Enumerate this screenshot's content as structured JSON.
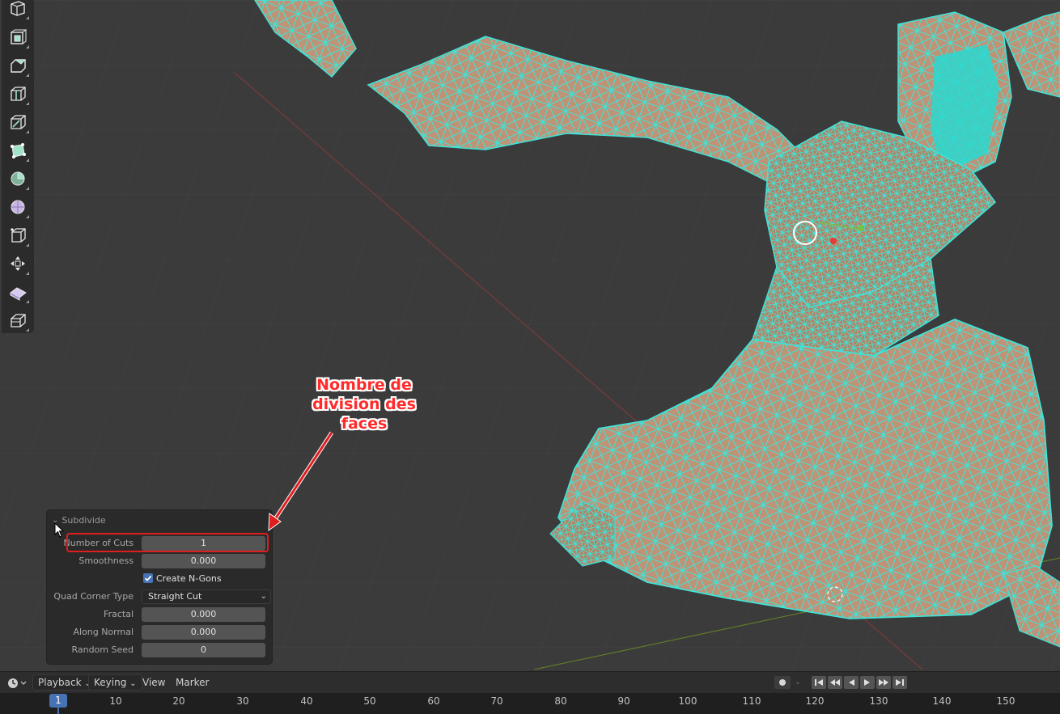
{
  "app": "Blender",
  "toolbar": {
    "tools": [
      "select-box-icon",
      "inset-faces-icon",
      "extrude-region-icon",
      "bevel-icon",
      "loop-cut-icon",
      "knife-icon",
      "poly-build-icon",
      "spin-icon",
      "smooth-vertices-icon",
      "edge-slide-icon",
      "shrink-fatten-icon",
      "shear-icon",
      "rip-region-icon"
    ]
  },
  "operator_panel": {
    "title": "Subdivide",
    "fields": {
      "number_of_cuts": {
        "label": "Number of Cuts",
        "value": "1"
      },
      "smoothness": {
        "label": "Smoothness",
        "value": "0.000"
      },
      "create_ngons": {
        "label": "Create N-Gons",
        "checked": true
      },
      "quad_corner_type": {
        "label": "Quad Corner Type",
        "value": "Straight Cut"
      },
      "fractal": {
        "label": "Fractal",
        "value": "0.000"
      },
      "along_normal": {
        "label": "Along Normal",
        "value": "0.000"
      },
      "random_seed": {
        "label": "Random Seed",
        "value": "0"
      }
    }
  },
  "annotation": {
    "line1": "Nombre de",
    "line2": "division des",
    "line3": "faces",
    "color": "#ff2b2b"
  },
  "timeline": {
    "menus": {
      "playback": "Playback",
      "keying": "Keying",
      "view": "View",
      "marker": "Marker"
    },
    "current_frame": "1",
    "frame_labels": [
      "10",
      "20",
      "30",
      "40",
      "50",
      "60",
      "70",
      "80",
      "90",
      "100",
      "110",
      "120",
      "130",
      "140",
      "150"
    ]
  },
  "colors": {
    "wireframe": "#35e0d6",
    "mesh": "#b07a52",
    "accent": "#4772b3",
    "highlight": "#e01e1e"
  }
}
